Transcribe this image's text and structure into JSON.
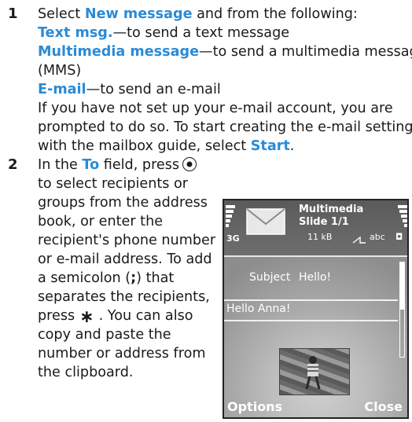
{
  "step1": {
    "number": "1",
    "intro_pre": "Select ",
    "intro_link": "New message",
    "intro_post": " and from the following:",
    "options": [
      {
        "link": "Text msg.",
        "desc": "—to send a text message"
      },
      {
        "link": "Multimedia message",
        "desc": "—to send a multimedia message"
      },
      {
        "cont": "(MMS)"
      },
      {
        "link": "E-mail",
        "desc": "—to send an e-mail"
      }
    ],
    "note_line1": "If you have not set up your e-mail account, you are",
    "note_line2": "prompted to do so. To start creating the e-mail settings",
    "note_line3_pre": "with the mailbox guide, select ",
    "note_line3_link": "Start",
    "note_line3_post": "."
  },
  "step2": {
    "number": "2",
    "lines": [
      {
        "pre": "In the ",
        "link": "To",
        "post": " field, press"
      },
      {
        "text": "to select recipients or"
      },
      {
        "text": "groups from the address"
      },
      {
        "text": "book, or enter the"
      },
      {
        "text": "recipient's phone number"
      },
      {
        "text": "or e-mail address. To add"
      },
      {
        "pre": "a semicolon (",
        "sym": ";",
        "post": ") that"
      },
      {
        "text": "separates the recipients,"
      },
      {
        "pre": "press",
        "star": "∗",
        "post": ". You can also"
      },
      {
        "text": "copy and paste the"
      },
      {
        "text": "number or address from"
      },
      {
        "text": "the clipboard."
      }
    ]
  },
  "phone": {
    "title_line1": "Multimedia",
    "title_line2": "Slide 1/1",
    "size": "11 kB",
    "network": "3G",
    "input_mode": "abc",
    "subject_label": "Subject",
    "subject_value": "Hello!",
    "body_text": "Hello Anna!",
    "left_softkey": "Options",
    "right_softkey": "Close"
  },
  "colors": {
    "accent": "#2a8bd6",
    "text": "#1a1a1a"
  }
}
